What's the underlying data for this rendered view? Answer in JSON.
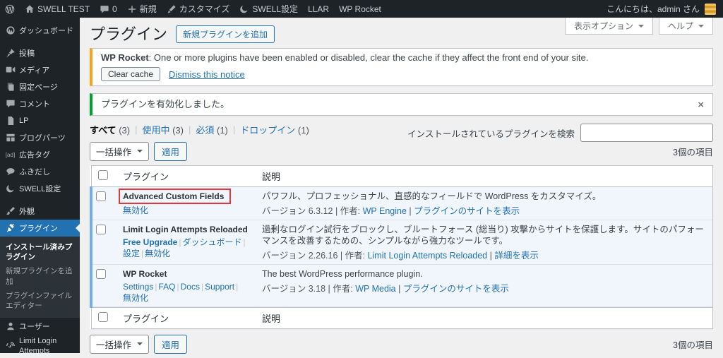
{
  "admin_bar": {
    "site_name": "SWELL TEST",
    "comments_count": "0",
    "new_label": "新規",
    "customize_label": "カスタマイズ",
    "swell_label": "SWELL設定",
    "llar_label": "LLAR",
    "wprocket_label": "WP Rocket",
    "greeting": "こんにちは、admin さん"
  },
  "sidebar": {
    "items": [
      {
        "label": "ダッシュボード",
        "icon": "dashboard-icon",
        "gap_after": true
      },
      {
        "label": "投稿",
        "icon": "pin-icon"
      },
      {
        "label": "メディア",
        "icon": "media-icon"
      },
      {
        "label": "固定ページ",
        "icon": "pages-icon"
      },
      {
        "label": "コメント",
        "icon": "comment-icon"
      },
      {
        "label": "LP",
        "icon": "page-icon"
      },
      {
        "label": "ブログパーツ",
        "icon": "grid-icon"
      },
      {
        "label": "広告タグ",
        "icon": "ad-icon",
        "icon_text": "[ad]"
      },
      {
        "label": "ふきだし",
        "icon": "speech-icon"
      },
      {
        "label": "SWELL設定",
        "icon": "swell-icon",
        "gap_after": true
      },
      {
        "label": "外観",
        "icon": "appearance-icon"
      },
      {
        "label": "プラグイン",
        "icon": "plugin-icon",
        "active": true,
        "submenu": [
          {
            "label": "インストール済みプラグイン",
            "current": true
          },
          {
            "label": "新規プラグインを追加"
          },
          {
            "label": "プラグインファイルエディター"
          }
        ]
      },
      {
        "label": "ユーザー",
        "icon": "users-icon"
      },
      {
        "label": "Limit Login Attempts",
        "icon": "llar-icon",
        "wrap": true
      }
    ]
  },
  "page": {
    "title": "プラグイン",
    "add_new_button": "新規プラグインを追加",
    "screen_options_button": "表示オプション",
    "help_button": "ヘルプ"
  },
  "notices": {
    "wprocket": {
      "title": "WP Rocket",
      "message": ": One or more plugins have been enabled or disabled, clear the cache if they affect the front end of your site.",
      "clear_cache_button": "Clear cache",
      "dismiss_link": "Dismiss this notice",
      "accent_color": "#f5a51d"
    },
    "activated": {
      "message": "プラグインを有効化しました。",
      "accent_color": "#00a32a"
    }
  },
  "filters": [
    {
      "label": "すべて",
      "count": "(3)",
      "current": true
    },
    {
      "label": "使用中",
      "count": "(3)"
    },
    {
      "label": "必須",
      "count": "(1)"
    },
    {
      "label": "ドロップイン",
      "count": "(1)"
    }
  ],
  "search": {
    "label": "インストールされているプラグインを検索",
    "value": ""
  },
  "bulk_actions": {
    "select_label": "一括操作",
    "apply_button": "適用",
    "items_count": "3個の項目"
  },
  "plugins_table": {
    "headers": {
      "name": "プラグイン",
      "description": "説明"
    },
    "rows": [
      {
        "name": "Advanced Custom Fields",
        "annotated": true,
        "actions": [
          {
            "label": "無効化"
          }
        ],
        "description": "パワフル、プロフェッショナル、直感的なフィールドで WordPress をカスタマイズ。",
        "meta": [
          {
            "text": "バージョン 6.3.12 | 作者: "
          },
          {
            "text": "WP Engine",
            "link": true
          },
          {
            "text": " | "
          },
          {
            "text": "プラグインのサイトを表示",
            "link": true
          }
        ]
      },
      {
        "name": "Limit Login Attempts Reloaded",
        "actions": [
          {
            "label": "Free Upgrade",
            "bold": true
          },
          {
            "label": "ダッシュボード"
          },
          {
            "label": "設定"
          },
          {
            "label": "無効化"
          }
        ],
        "description": "過剰なログイン試行をブロックし、ブルートフォース (総当り) 攻撃からサイトを保護します。サイトのパフォーマンスを改善するための、シンプルながら強力なツールです。",
        "meta": [
          {
            "text": "バージョン 2.26.16 | 作者: "
          },
          {
            "text": "Limit Login Attempts Reloaded",
            "link": true
          },
          {
            "text": " | "
          },
          {
            "text": "詳細を表示",
            "link": true
          }
        ]
      },
      {
        "name": "WP Rocket",
        "actions": [
          {
            "label": "Settings"
          },
          {
            "label": "FAQ"
          },
          {
            "label": "Docs"
          },
          {
            "label": "Support"
          },
          {
            "label": "無効化"
          }
        ],
        "description": "The best WordPress performance plugin.",
        "meta": [
          {
            "text": "バージョン 3.18 | 作者: "
          },
          {
            "text": "WP Media",
            "link": true
          },
          {
            "text": " | "
          },
          {
            "text": "プラグインのサイトを表示",
            "link": true
          }
        ]
      }
    ]
  },
  "colors": {
    "accent": "#2271b1",
    "active_row_bg": "#f0f6fc",
    "active_row_stripe": "#72aee6"
  }
}
